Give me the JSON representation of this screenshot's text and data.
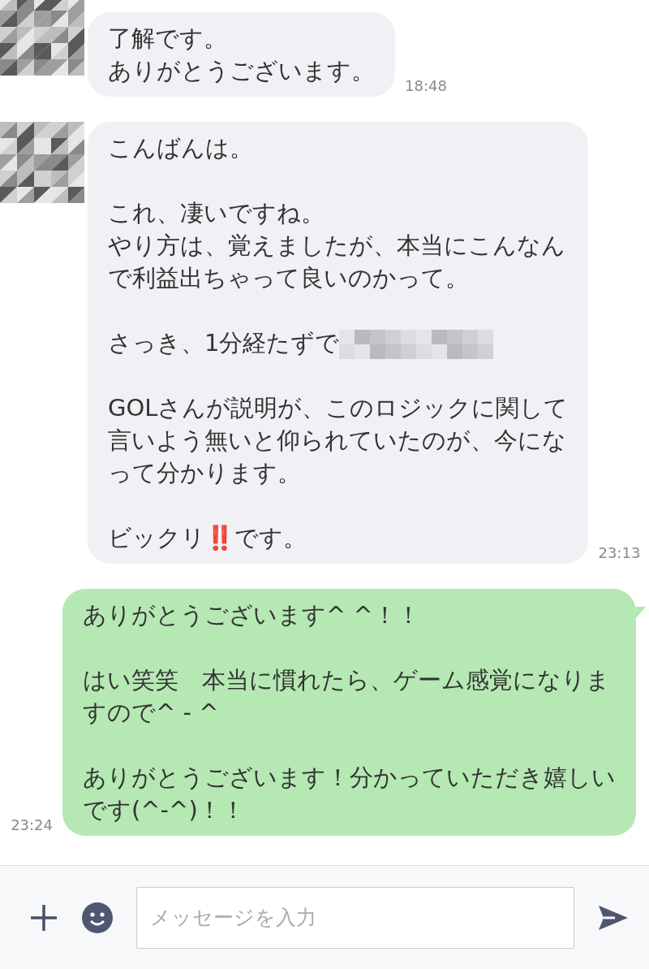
{
  "messages": [
    {
      "kind": "received",
      "time": "18:48",
      "paragraphs": [
        {
          "kind": "text",
          "lines": [
            "了解です。",
            "ありがとうございます。"
          ]
        }
      ]
    },
    {
      "kind": "received",
      "time": "23:13",
      "paragraphs": [
        {
          "kind": "text",
          "lines": [
            "こんばんは。"
          ]
        },
        {
          "kind": "text",
          "lines": [
            "これ、凄いですね。",
            "やり方は、覚えましたが、本当にこんなん",
            "で利益出ちゃって良いのかって。"
          ]
        },
        {
          "kind": "redacted",
          "lines": [
            "さっき、1分経たずで"
          ]
        },
        {
          "kind": "text",
          "lines": [
            "GOLさんが説明が、このロジックに関して",
            "言いよう無いと仰られていたのが、今にな",
            "って分かります。"
          ]
        },
        {
          "kind": "text",
          "lines": [
            "ビックリ‼️です。"
          ]
        }
      ]
    },
    {
      "kind": "sent",
      "time": "23:24",
      "paragraphs": [
        {
          "kind": "text",
          "lines": [
            "ありがとうございます^ ^！！"
          ]
        },
        {
          "kind": "text",
          "lines": [
            "はい笑笑　本当に慣れたら、ゲーム感覚になりま",
            "すので^ - ^"
          ]
        },
        {
          "kind": "text",
          "lines": [
            "ありがとうございます！分かっていただき嬉しい",
            "です(^-^)！！"
          ]
        }
      ]
    }
  ],
  "composer": {
    "placeholder": "メッセージを入力"
  }
}
